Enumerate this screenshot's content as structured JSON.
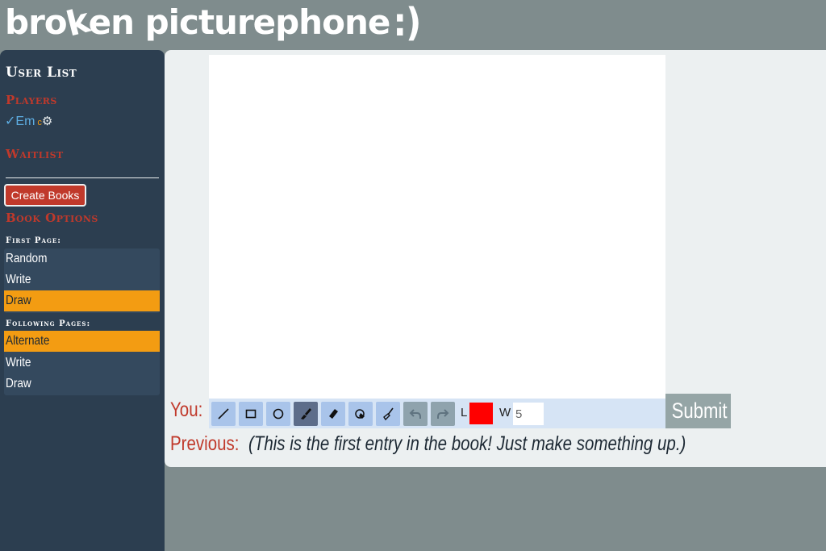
{
  "app": {
    "title_before": "bro",
    "title_k": "k",
    "title_after": "en picturephone",
    "title_mark": ":)"
  },
  "sidebar": {
    "user_list_heading": "User List",
    "players_heading": "Players",
    "players": [
      {
        "check": "✓",
        "name": "Em",
        "host_dot": "c",
        "gear": "⚙"
      }
    ],
    "waitlist_heading": "Waitlist",
    "create_books_label": "Create Books",
    "book_options_heading": "Book Options",
    "first_page_heading": "First Page:",
    "first_page_options": [
      "Random",
      "Write",
      "Draw"
    ],
    "first_page_selected": "Draw",
    "following_pages_heading": "Following Pages:",
    "following_pages_options": [
      "Alternate",
      "Write",
      "Draw"
    ],
    "following_pages_selected": "Alternate"
  },
  "main": {
    "you_label": "You:",
    "toolbar": {
      "tools": [
        "line-tool-icon",
        "rectangle-tool-icon",
        "circle-tool-icon",
        "fill-tool-icon",
        "eraser-tool-icon",
        "erase-shape-tool-icon",
        "clear-tool-icon",
        "undo-icon",
        "redo-icon"
      ],
      "active_tool": "fill-tool-icon",
      "line_color_label": "L",
      "line_color": "#ff0000",
      "width_label": "W",
      "width_value": "5"
    },
    "submit_label": "Submit",
    "previous_label": "Previous:",
    "previous_text": "(This is the first entry in the book! Just make something up.)"
  },
  "colors": {
    "background": "#7f8c8d",
    "sidebar": "#2c3e50",
    "accent_red": "#c0392b",
    "selected_orange": "#f39c12",
    "panel": "#ecf0f1"
  }
}
